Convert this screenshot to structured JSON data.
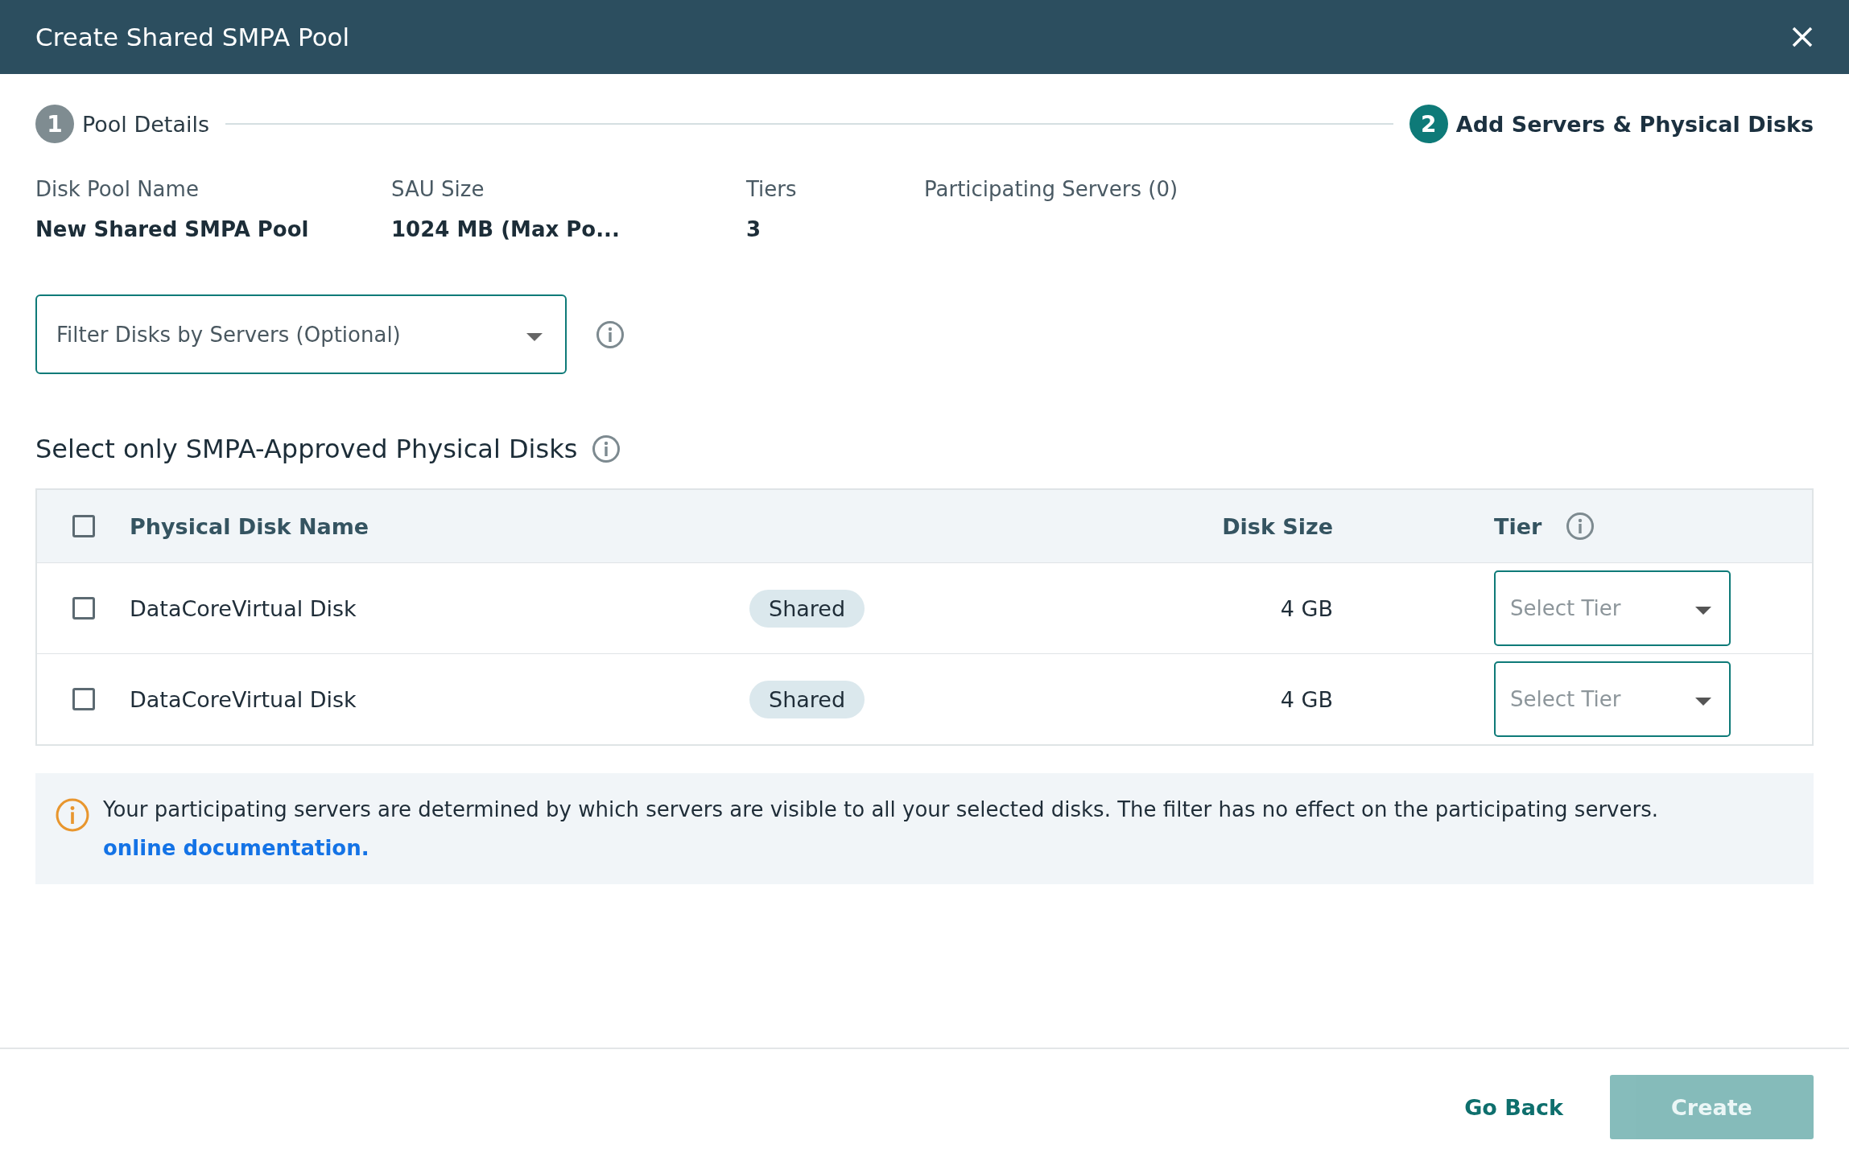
{
  "window": {
    "title": "Create Shared SMPA Pool"
  },
  "steps": [
    {
      "number": "1",
      "label": "Pool Details",
      "selected": false
    },
    {
      "number": "2",
      "label": "Add Servers & Physical Disks",
      "selected": true
    }
  ],
  "details": [
    {
      "label": "Disk Pool Name",
      "value": "New Shared SMPA Pool"
    },
    {
      "label": "SAU Size",
      "value": "1024 MB (Max Po..."
    },
    {
      "label": "Tiers",
      "value": "3"
    },
    {
      "label": "Participating Servers (0)"
    }
  ],
  "filter": {
    "placeholder": "Filter Disks by Servers (Optional)"
  },
  "section_title": "Select only SMPA-Approved Physical Disks",
  "table": {
    "select_all_checked": false,
    "columns": [
      "Physical Disk Name",
      "Disk Size",
      "Tier"
    ],
    "rows": [
      {
        "checked": false,
        "name": "DataCoreVirtual Disk",
        "tag": "Shared",
        "size": "4 GB",
        "tier_placeholder": "Select Tier"
      },
      {
        "checked": false,
        "name": "DataCoreVirtual Disk",
        "tag": "Shared",
        "size": "4 GB",
        "tier_placeholder": "Select Tier"
      }
    ]
  },
  "notice": {
    "text": "Your participating servers are determined by which servers are visible to all your selected disks. The filter has no effect on the participating servers.",
    "link": "online documentation."
  },
  "buttons": [
    {
      "kind": "link",
      "label": "Go Back",
      "disabled": false
    },
    {
      "kind": "primary",
      "label": "Create",
      "disabled": true
    }
  ]
}
